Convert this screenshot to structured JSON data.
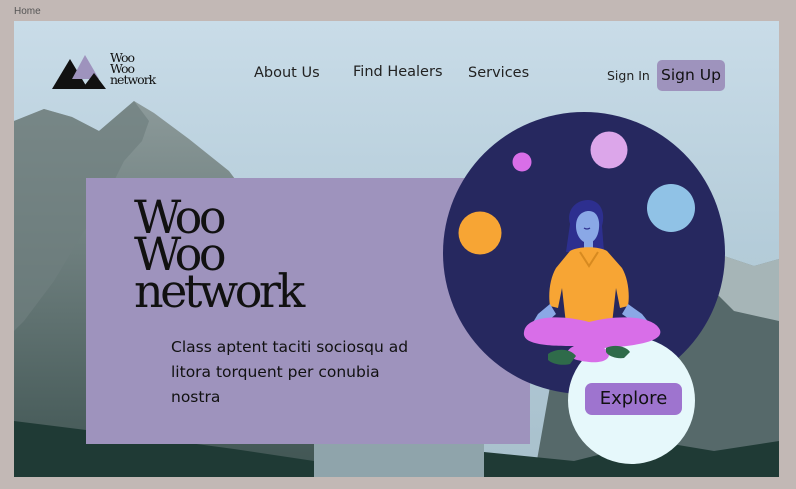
{
  "browser": {
    "tab_label": "Home"
  },
  "logo": {
    "line1": "Woo",
    "line2": "Woo",
    "line3": "network"
  },
  "nav": {
    "links": [
      "About Us",
      "Find Healers",
      "Services"
    ],
    "sign_in": "Sign In",
    "sign_up": "Sign Up"
  },
  "hero": {
    "title_line1": "Woo",
    "title_line2": "Woo",
    "title_line3": "network",
    "description": "Class aptent taciti sociosqu ad litora torquent per conubia nostra",
    "cta": "Explore"
  },
  "colors": {
    "page_bg": "#c2b8b5",
    "lavender": "#9e93bd",
    "navy_circle": "#26285f",
    "explore_button": "#9e74cf",
    "mint_circle": "#e6f8fb",
    "orange": "#f7a534"
  },
  "icons": [
    "meditating-person-illustration",
    "mountain-logo-icon",
    "mountain-background-image"
  ]
}
